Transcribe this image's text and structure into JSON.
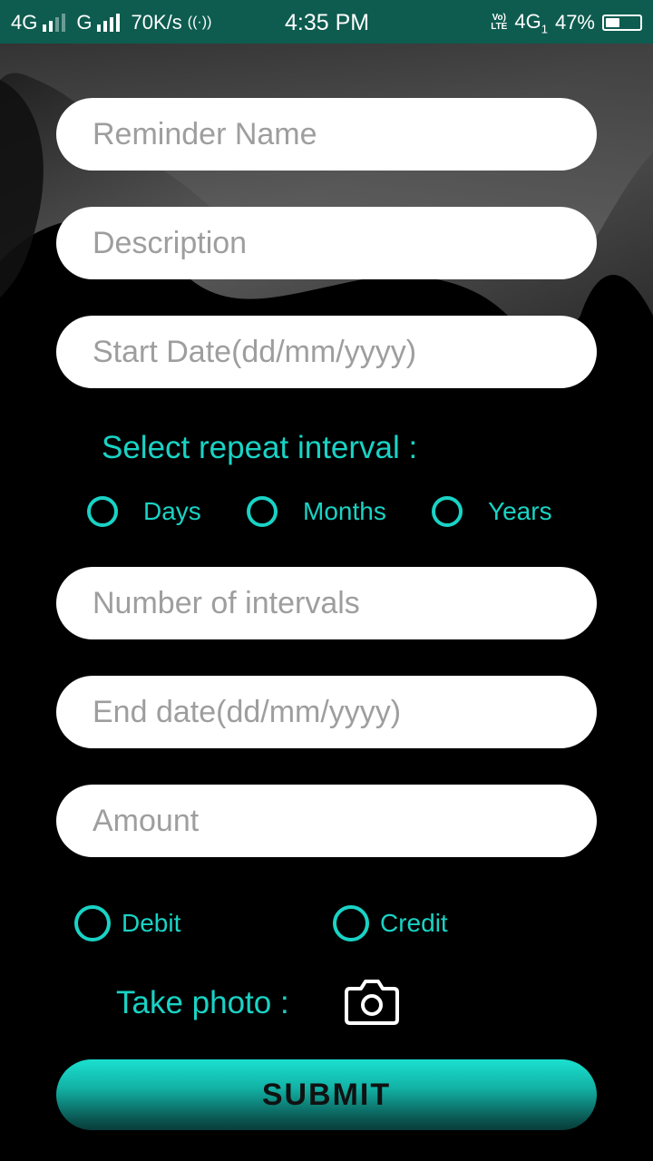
{
  "status_bar": {
    "network1": "4G",
    "network2": "G",
    "speed": "70K/s",
    "time": "4:35 PM",
    "volte_top": "Vo)",
    "volte_bottom": "LTE",
    "network3": "4G",
    "sim_slot": "1",
    "battery": "47%",
    "battery_level_percent": 47
  },
  "form": {
    "reminder_name": {
      "value": "",
      "placeholder": "Reminder Name"
    },
    "description": {
      "value": "",
      "placeholder": "Description"
    },
    "start_date": {
      "value": "",
      "placeholder": "Start Date(dd/mm/yyyy)"
    },
    "repeat_label": "Select repeat interval :",
    "repeat_options": [
      "Days",
      "Months",
      "Years"
    ],
    "num_intervals": {
      "value": "",
      "placeholder": "Number of intervals"
    },
    "end_date": {
      "value": "",
      "placeholder": "End date(dd/mm/yyyy)"
    },
    "amount": {
      "value": "",
      "placeholder": "Amount"
    },
    "type_options": [
      "Debit",
      "Credit"
    ],
    "photo_label": "Take photo :",
    "photo_icon": "camera-icon",
    "submit_label": "SUBMIT"
  },
  "colors": {
    "status_bar": "#0d5c4f",
    "accent": "#19d3c5",
    "background": "#000000"
  }
}
